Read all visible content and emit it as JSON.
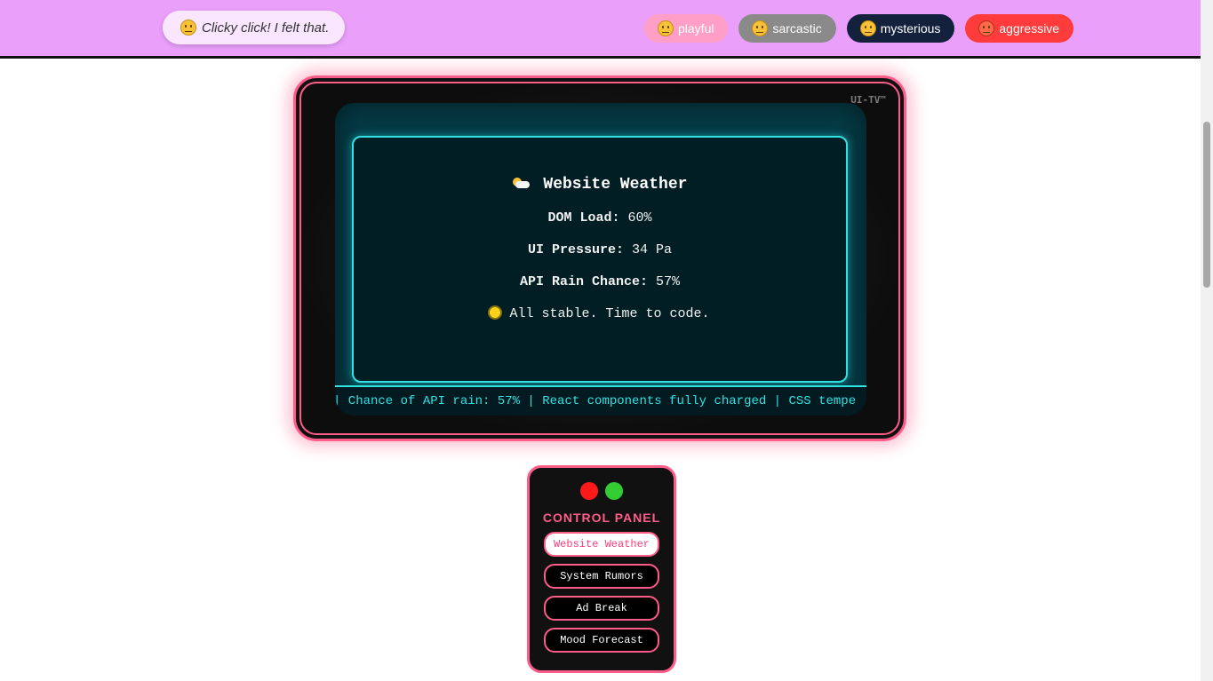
{
  "topbar": {
    "speech_text": "Clicky click! I felt that.",
    "speech_icon": "neutral-face-icon",
    "moods": [
      {
        "label": "playful",
        "icon": "grin-face-icon",
        "color": "#ff9ec6"
      },
      {
        "label": "sarcastic",
        "icon": "eye-roll-face-icon",
        "color": "#8a8a8a"
      },
      {
        "label": "mysterious",
        "icon": "neutral-face-icon",
        "color": "#14213d"
      },
      {
        "label": "aggressive",
        "icon": "angry-face-icon",
        "color": "#ff3b3b"
      }
    ]
  },
  "tv": {
    "brand": "UI-TV™",
    "panel": {
      "title": "Website Weather",
      "title_icon": "sun-behind-cloud-icon",
      "dom_load_label": "DOM Load:",
      "dom_load_value": "60%",
      "ui_pressure_label": "UI Pressure:",
      "ui_pressure_value": "34 Pa",
      "api_rain_label": "API Rain Chance:",
      "api_rain_value": "57%",
      "status_icon": "sun-icon",
      "status_text": "All stable. Time to code."
    },
    "ticker": "| Chance of API rain: 57% | React components fully charged | CSS tempe"
  },
  "control_panel": {
    "title": "CONTROL PANEL",
    "buttons": [
      "Website Weather",
      "System Rumors",
      "Ad Break",
      "Mood Forecast"
    ],
    "active": "Website Weather"
  },
  "colors": {
    "topbar": "#eaa0fb",
    "accent_pink": "#ff5c8a",
    "screen_cyan": "#2fe3e3"
  }
}
